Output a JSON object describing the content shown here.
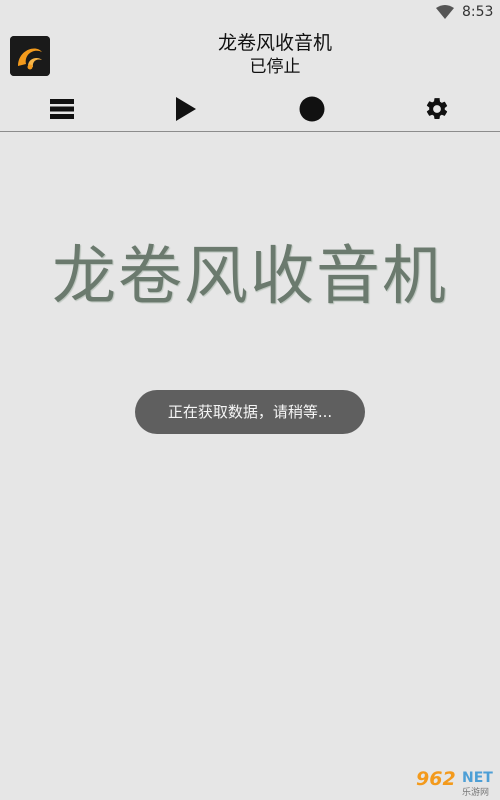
{
  "status_bar": {
    "time": "8:53",
    "wifi_icon": "wifi-icon"
  },
  "app_bar": {
    "logo_icon": "tornado-radio-logo-icon",
    "title": "龙卷风收音机",
    "status": "已停止"
  },
  "toolbar": {
    "items": [
      {
        "icon": "list-icon"
      },
      {
        "icon": "play-icon"
      },
      {
        "icon": "record-icon"
      },
      {
        "icon": "gear-icon"
      }
    ]
  },
  "main": {
    "title": "龙卷风收音机"
  },
  "toast": {
    "message": "正在获取数据，请稍等..."
  },
  "watermark": {
    "number": "962",
    "net": "NET",
    "sub": "乐游网"
  },
  "colors": {
    "background": "#e6e6e6",
    "title_green_gray": "#6b7a6e",
    "toast_bg": "#5f5f5f",
    "logo_orange": "#f39a1c"
  }
}
